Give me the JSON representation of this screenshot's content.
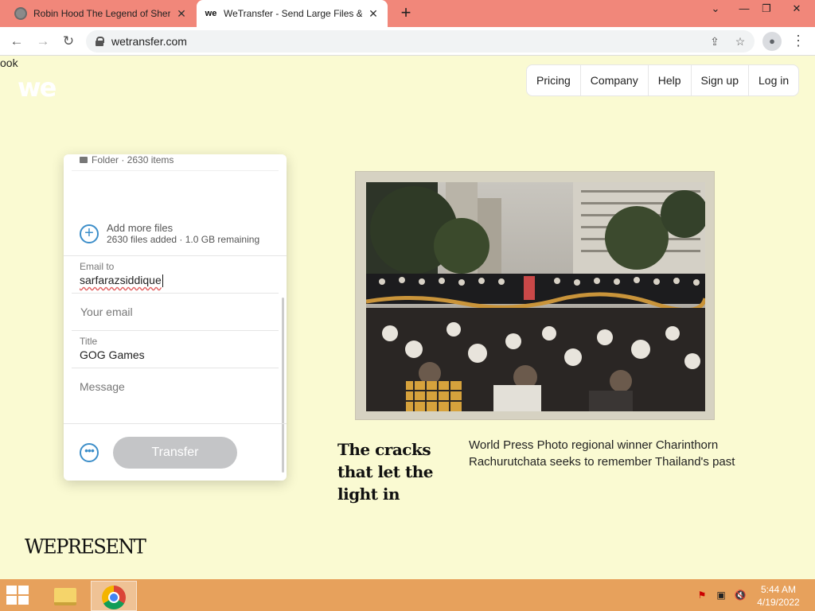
{
  "browser": {
    "tabs": [
      {
        "title": "Robin Hood The Legend of Sherwood",
        "active": false
      },
      {
        "title": "WeTransfer - Send Large Files & Share Photos Online",
        "active": true
      }
    ],
    "address": "wetransfer.com"
  },
  "page": {
    "clipped_text": "ook",
    "logo": "we",
    "nav": [
      "Pricing",
      "Company",
      "Help",
      "Sign up",
      "Log in"
    ],
    "card": {
      "folder_label": "Folder · 2630 items",
      "add_more_title": "Add more files",
      "add_more_sub": "2630 files added · 1.0 GB remaining",
      "email_to_label": "Email to",
      "email_to_value": "sarfarazsiddique",
      "your_email_placeholder": "Your email",
      "title_label": "Title",
      "title_value": "GOG Games",
      "message_placeholder": "Message",
      "transfer_label": "Transfer"
    },
    "feature": {
      "headline": "The cracks that let the light in",
      "subtext": "World Press Photo regional winner Charinthorn Rachurutchata seeks to remember Thailand's past"
    },
    "brand_footer": "WEPRESENT"
  },
  "taskbar": {
    "time": "5:44 AM",
    "date": "4/19/2022"
  },
  "colors": {
    "page_bg": "#fafad2",
    "tabstrip": "#f1877a",
    "taskbar": "#e7a15c",
    "accent_blue": "#3c8ec9"
  }
}
